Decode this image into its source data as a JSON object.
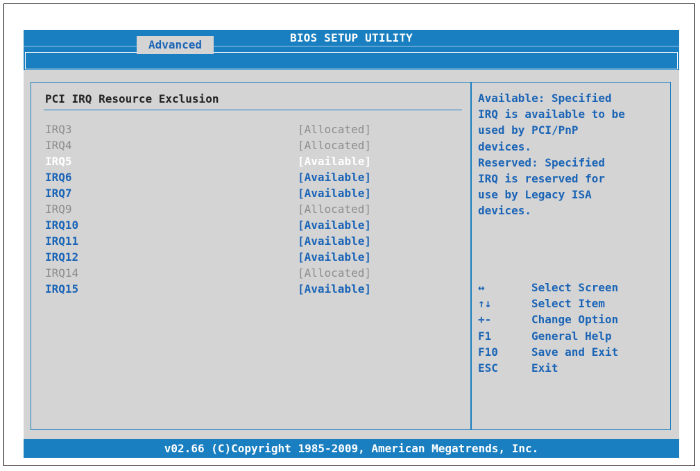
{
  "header": {
    "title": "BIOS SETUP UTILITY"
  },
  "tabs": [
    {
      "label": "Advanced",
      "active": true
    }
  ],
  "section": {
    "title": "PCI IRQ Resource Exclusion"
  },
  "irqs": [
    {
      "label": "IRQ3",
      "value": "[Allocated]",
      "state": "allocated"
    },
    {
      "label": "IRQ4",
      "value": "[Allocated]",
      "state": "allocated"
    },
    {
      "label": "IRQ5",
      "value": "[Available]",
      "state": "selected"
    },
    {
      "label": "IRQ6",
      "value": "[Available]",
      "state": "available"
    },
    {
      "label": "IRQ7",
      "value": "[Available]",
      "state": "available"
    },
    {
      "label": "IRQ9",
      "value": "[Allocated]",
      "state": "allocated"
    },
    {
      "label": "IRQ10",
      "value": "[Available]",
      "state": "available"
    },
    {
      "label": "IRQ11",
      "value": "[Available]",
      "state": "available"
    },
    {
      "label": "IRQ12",
      "value": "[Available]",
      "state": "available"
    },
    {
      "label": "IRQ14",
      "value": "[Allocated]",
      "state": "allocated"
    },
    {
      "label": "IRQ15",
      "value": "[Available]",
      "state": "available"
    }
  ],
  "help": {
    "lines": [
      "Available: Specified",
      "IRQ is available to be",
      "used by PCI/PnP",
      "devices.",
      "Reserved: Specified",
      "IRQ is reserved for",
      "use by Legacy ISA",
      "devices."
    ]
  },
  "keys": [
    {
      "key": "↔",
      "desc": "Select Screen",
      "icon": "left-right-arrow-icon"
    },
    {
      "key": "↑↓",
      "desc": "Select Item",
      "icon": "up-down-arrow-icon"
    },
    {
      "key": "+-",
      "desc": "Change Option"
    },
    {
      "key": "F1",
      "desc": "General Help"
    },
    {
      "key": "F10",
      "desc": "Save and Exit"
    },
    {
      "key": "ESC",
      "desc": "Exit"
    }
  ],
  "footer": {
    "text": "v02.66 (C)Copyright 1985-2009, American Megatrends, Inc."
  },
  "colors": {
    "bar_blue": "#1a7fc0",
    "text_blue": "#1a64b6",
    "panel_gray": "#d4d4d4",
    "disabled_gray": "#8c8c8c"
  }
}
